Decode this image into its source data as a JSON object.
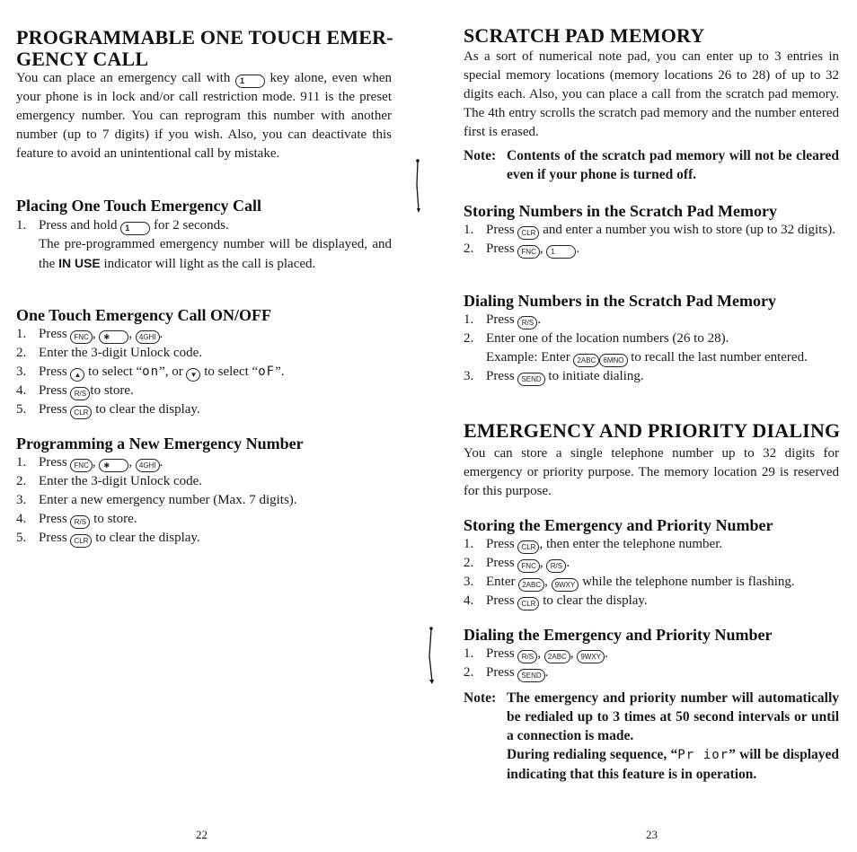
{
  "left_page": {
    "page_number": "22",
    "section_title_line1": "PROGRAMMABLE ONE TOUCH EMER-",
    "section_title_line2": "GENCY CALL",
    "intro": {
      "before_key": "You can place an emergency call with",
      "key": "1",
      "after_key": "key alone, even when your phone is in lock and/or call restriction mode. 911 is the preset emergency number. You can reprogram this number with another number (up to 7 digits) if you wish. Also, you can deactivate this feature to avoid an unintentional call by mistake."
    },
    "placing": {
      "title": "Placing One Touch Emergency Call",
      "step1_before": "Press and hold",
      "step1_key": "1",
      "step1_after": "for 2 seconds.",
      "step1_cont_before": "The pre-programmed emergency number will be displayed, and the",
      "step1_cont_strong": "IN USE",
      "step1_cont_after": "indicator will light as the call is placed."
    },
    "onoff": {
      "title": "One Touch Emergency Call ON/OFF",
      "steps": [
        {
          "num": "1.",
          "text": "Press",
          "keys": [
            "FNC",
            "✱",
            "4GHI"
          ]
        },
        {
          "num": "2.",
          "text": "Enter the 3-digit Unlock code."
        },
        {
          "num": "3.",
          "text": "Press",
          "up_key": "▲",
          "mid": "to select",
          "on_display": "on",
          "or": ", or",
          "down_key": "▼",
          "end": "to select",
          "off_display": "oF"
        },
        {
          "num": "4.",
          "text": "Press",
          "key": "R/S",
          "after": "to store."
        },
        {
          "num": "5.",
          "text": "Press",
          "key": "CLR",
          "after": "to clear the display."
        }
      ]
    },
    "programming": {
      "title": "Programming a New Emergency Number",
      "steps": [
        {
          "num": "1.",
          "text": "Press",
          "keys": [
            "FNC",
            "✱",
            "4GHI"
          ]
        },
        {
          "num": "2.",
          "text": "Enter the 3-digit Unlock code."
        },
        {
          "num": "3.",
          "text": "Enter a new emergency number (Max. 7 digits)."
        },
        {
          "num": "4.",
          "text": "Press",
          "key": "R/S",
          "after": "to store."
        },
        {
          "num": "5.",
          "text": "Press",
          "key": "CLR",
          "after": "to clear the display."
        }
      ]
    }
  },
  "right_page": {
    "page_number": "23",
    "scratch": {
      "title": "SCRATCH PAD MEMORY",
      "intro": "As a sort of numerical note pad, you can enter up to 3 entries in special memory locations (memory locations 26 to 28) of up to 32 digits each. Also, you can place a call from the scratch pad memory. The 4th entry scrolls the scratch pad memory and the number entered first is erased.",
      "note_label": "Note:",
      "note_text": "Contents of the scratch pad memory will not be cleared even if your phone is turned off."
    },
    "storing_scratch": {
      "title": "Storing Numbers in the Scratch Pad Memory",
      "steps": [
        {
          "num": "1.",
          "text": "Press",
          "key": "CLR",
          "after": "and enter a number you wish to store (up to 32 digits)."
        },
        {
          "num": "2.",
          "text": "Press",
          "keys": [
            "FNC",
            "1"
          ]
        }
      ]
    },
    "dialing_scratch": {
      "title": "Dialing Numbers in the Scratch Pad Memory",
      "steps": [
        {
          "num": "1.",
          "text": "Press",
          "key": "R/S"
        },
        {
          "num": "2.",
          "text": "Enter one of the location numbers (26 to 28)."
        },
        {
          "num": "3.",
          "text": "Press",
          "key": "SEND",
          "after": "to initiate dialing."
        }
      ],
      "example_before": "Example: Enter",
      "example_keys": [
        "2ABC",
        "6MNO"
      ],
      "example_after": "to recall the last number entered."
    },
    "emergency": {
      "title": "EMERGENCY AND PRIORITY DIALING",
      "intro": "You can store a single telephone number up to 32 digits for emergency or priority purpose. The memory location 29 is reserved for this purpose."
    },
    "storing_emergency": {
      "title": "Storing the Emergency and Priority Number",
      "steps": [
        {
          "num": "1.",
          "text": "Press",
          "key": "CLR",
          "after": ", then enter the telephone number."
        },
        {
          "num": "2.",
          "text": "Press",
          "keys": [
            "FNC",
            "R/S"
          ]
        },
        {
          "num": "3.",
          "text": "Enter",
          "keys": [
            "2ABC",
            "9WXY"
          ],
          "after": "while the telephone number is flashing."
        },
        {
          "num": "4.",
          "text": "Press",
          "key": "CLR",
          "after": "to clear the display."
        }
      ]
    },
    "dialing_emergency": {
      "title": "Dialing the Emergency and Priority Number",
      "steps": [
        {
          "num": "1.",
          "text": "Press",
          "keys": [
            "R/S",
            "2ABC",
            "9WXY"
          ]
        },
        {
          "num": "2.",
          "text": "Press",
          "key": "SEND"
        }
      ],
      "note_label": "Note:",
      "note_text1": "The emergency and priority number will automatically be redialed up to 3 times at 50 second intervals or until a connection is made.",
      "note_text2_before": "During redialing sequence, “",
      "note_display": "Pr ior",
      "note_text2_after": "” will be displayed indicating that this feature is in operation."
    }
  }
}
